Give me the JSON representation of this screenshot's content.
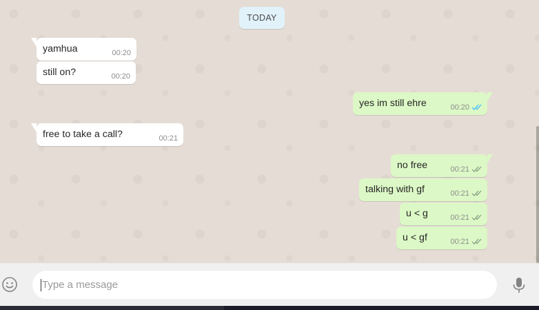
{
  "date_chip": "TODAY",
  "messages": [
    {
      "text": "yamhua",
      "time": "00:20"
    },
    {
      "text": "still on?",
      "time": "00:20"
    },
    {
      "text": "yes im still ehre",
      "time": "00:20"
    },
    {
      "text": "free to take a call?",
      "time": "00:21"
    },
    {
      "text": "no free",
      "time": "00:21"
    },
    {
      "text": "talking with gf",
      "time": "00:21"
    },
    {
      "text": "u < g",
      "time": "00:21"
    },
    {
      "text": "u < gf",
      "time": "00:21"
    }
  ],
  "composer": {
    "placeholder": "Type a message"
  },
  "icons": {
    "emoji": "emoji-icon",
    "mic": "microphone-icon",
    "read_ticks": "double-check-icon"
  },
  "colors": {
    "incoming": "#ffffff",
    "outgoing": "#dcf8c6",
    "read_tick": "#4fc3f7",
    "delivered_tick": "#92a58c"
  }
}
